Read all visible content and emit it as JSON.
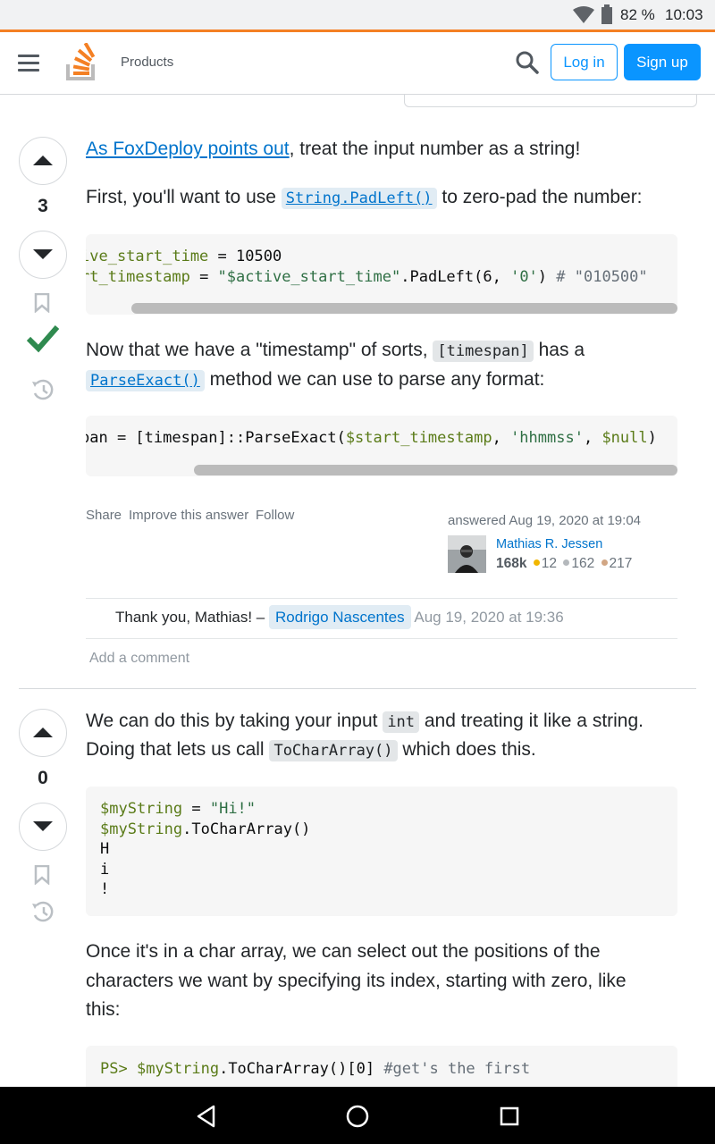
{
  "status": {
    "battery": "82 %",
    "time": "10:03"
  },
  "header": {
    "products": "Products",
    "login": "Log in",
    "signup": "Sign up"
  },
  "answer1": {
    "score": "3",
    "intro_link": "As FoxDeploy points out",
    "intro_rest": ", treat the input number as a string!",
    "p2_a": "First, you'll want to use",
    "p2_code": "String.PadLeft()",
    "p2_b": "to zero-pad the number:",
    "code1_line1_a": "ive_start_time",
    "code1_line1_b": " = 10500",
    "code1_line2_a": "rt_timestamp",
    "code1_line2_b": " = ",
    "code1_line2_str": "\"$active_start_time\"",
    "code1_line2_c": ".PadLeft(6, ",
    "code1_line2_str2": "'0'",
    "code1_line2_d": ") ",
    "code1_line2_com": "# \"010500\"",
    "p3_a": "Now that we have a \"timestamp\" of sorts,",
    "p3_code": "[timespan]",
    "p3_b": "has a",
    "p3_code2": "ParseExact()",
    "p3_c": "method we can use to parse any format:",
    "code2_a": "pan = [timespan]::ParseExact(",
    "code2_var": "$start_timestamp",
    "code2_b": ", ",
    "code2_str": "'hhmmss'",
    "code2_c": ", ",
    "code2_null": "$null",
    "code2_d": ")",
    "share": "Share",
    "improve": "Improve this answer",
    "follow": "Follow",
    "answered": "answered Aug 19, 2020 at 19:04",
    "user": "Mathias R. Jessen",
    "rep": "168k",
    "gold": "12",
    "silver": "162",
    "bronze": "217",
    "comment_text": "Thank you, Mathias! –",
    "comment_user": "Rodrigo Nascentes",
    "comment_time": "Aug 19, 2020 at 19:36",
    "add_comment": "Add a comment"
  },
  "answer2": {
    "score": "0",
    "p1_a": "We can do this by taking your input",
    "p1_code": "int",
    "p1_b": "and treating it like a string.",
    "p1_c": "Doing that lets us call",
    "p1_code2": "ToCharArray()",
    "p1_d": "which does this.",
    "code_l1_var": "$myString",
    "code_l1_b": " = ",
    "code_l1_str": "\"Hi!\"",
    "code_l2_var": "$myString",
    "code_l2_b": ".ToCharArray()",
    "code_l3": "H",
    "code_l4": "i",
    "code_l5": "!",
    "p2_l1": "Once it's in a char array, we can select out the positions of the",
    "p2_l2": "characters we want by specifying its index, starting with zero, like",
    "p2_l3": "this:",
    "code3_prompt": "PS> ",
    "code3_var": "$myString",
    "code3_b": ".ToCharArray()[0] ",
    "code3_com": "#get's the first"
  },
  "icons": {
    "menu": "hamburger-menu-icon",
    "logo": "stackoverflow-logo-icon",
    "search": "search-icon",
    "upvote": "upvote-arrow-icon",
    "downvote": "downvote-arrow-icon",
    "bookmark": "bookmark-icon",
    "accepted": "accepted-checkmark-icon",
    "history": "history-icon"
  },
  "colors": {
    "accent": "#f48024",
    "primary": "#0a95ff",
    "accepted": "#2f6f44"
  }
}
